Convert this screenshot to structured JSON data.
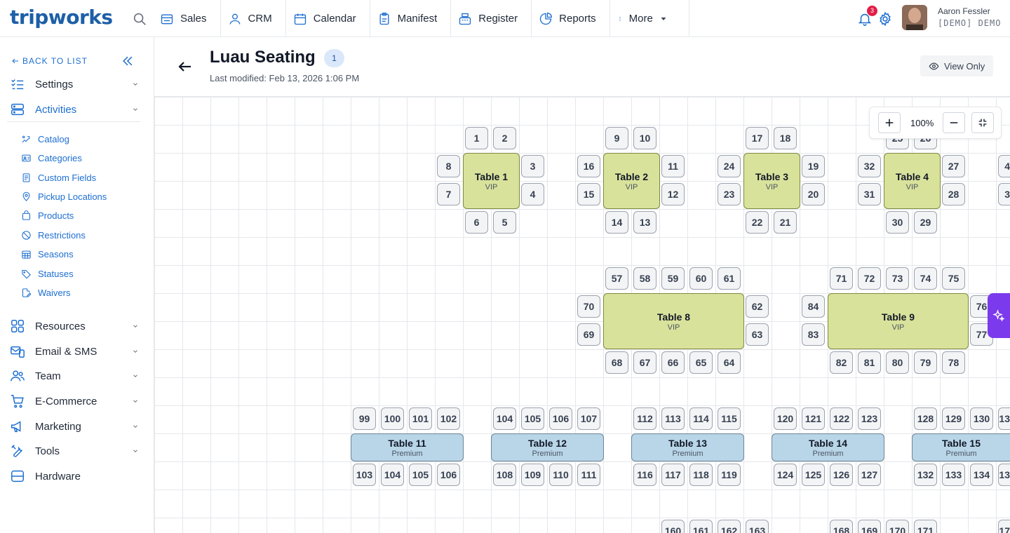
{
  "app": {
    "logo": "tripworks"
  },
  "nav": [
    {
      "key": "sales",
      "label": "Sales"
    },
    {
      "key": "crm",
      "label": "CRM"
    },
    {
      "key": "calendar",
      "label": "Calendar"
    },
    {
      "key": "manifest",
      "label": "Manifest"
    },
    {
      "key": "register",
      "label": "Register"
    },
    {
      "key": "reports",
      "label": "Reports"
    },
    {
      "key": "more",
      "label": "More"
    }
  ],
  "user": {
    "name": "Aaron Fessler",
    "org": "[DEMO] DEMO",
    "notifications": "3"
  },
  "sidebar": {
    "back_label": "BACK TO LIST",
    "sections": [
      {
        "label": "Settings",
        "icon": "settings-list-icon"
      },
      {
        "label": "Activities",
        "icon": "activities-stack-icon"
      },
      {
        "label": "Resources",
        "icon": "resources-grid-icon"
      },
      {
        "label": "Email & SMS",
        "icon": "email-sms-icon"
      },
      {
        "label": "Team",
        "icon": "team-icon"
      },
      {
        "label": "E-Commerce",
        "icon": "cart-icon"
      },
      {
        "label": "Marketing",
        "icon": "megaphone-icon"
      },
      {
        "label": "Tools",
        "icon": "tools-icon"
      },
      {
        "label": "Hardware",
        "icon": "hardware-icon"
      }
    ],
    "sub_items": [
      {
        "label": "Catalog",
        "icon": "catalog-icon"
      },
      {
        "label": "Categories",
        "icon": "categories-icon"
      },
      {
        "label": "Custom Fields",
        "icon": "custom-fields-icon"
      },
      {
        "label": "Pickup Locations",
        "icon": "pin-icon"
      },
      {
        "label": "Products",
        "icon": "bag-icon"
      },
      {
        "label": "Restrictions",
        "icon": "ban-icon"
      },
      {
        "label": "Seasons",
        "icon": "calendar-grid-icon"
      },
      {
        "label": "Statuses",
        "icon": "tag-icon"
      },
      {
        "label": "Waivers",
        "icon": "waiver-icon"
      }
    ]
  },
  "header": {
    "title": "Luau Seating",
    "badge": "1",
    "modified": "Last modified: Feb 13, 2026 1:06 PM",
    "view_only": "View Only"
  },
  "zoom": {
    "level": "100%"
  },
  "tables": [
    {
      "name": "Table 1",
      "type": "VIP"
    },
    {
      "name": "Table 2",
      "type": "VIP"
    },
    {
      "name": "Table 3",
      "type": "VIP"
    },
    {
      "name": "Table 4",
      "type": "VIP"
    },
    {
      "name": "Table 8",
      "type": "VIP"
    },
    {
      "name": "Table 9",
      "type": "VIP"
    },
    {
      "name": "Table 11",
      "type": "Premium"
    },
    {
      "name": "Table 12",
      "type": "Premium"
    },
    {
      "name": "Table 13",
      "type": "Premium"
    },
    {
      "name": "Table 14",
      "type": "Premium"
    },
    {
      "name": "Table 15",
      "type": "Premium"
    }
  ],
  "seats": {
    "t1": [
      "1",
      "2",
      "8",
      "7",
      "3",
      "4",
      "6",
      "5"
    ],
    "t2": [
      "9",
      "10",
      "16",
      "15",
      "11",
      "12",
      "14",
      "13"
    ],
    "t3": [
      "17",
      "18",
      "24",
      "23",
      "19",
      "20",
      "22",
      "21"
    ],
    "t4": [
      "25",
      "26",
      "32",
      "31",
      "27",
      "28",
      "30",
      "29"
    ],
    "t4_right_edge": [
      "4",
      "3"
    ],
    "t8": [
      "57",
      "58",
      "59",
      "60",
      "61",
      "70",
      "69",
      "62",
      "63",
      "68",
      "67",
      "66",
      "65",
      "64"
    ],
    "t9": [
      "71",
      "72",
      "73",
      "74",
      "75",
      "84",
      "83",
      "76",
      "77",
      "82",
      "81",
      "80",
      "79",
      "78"
    ],
    "t11": [
      "99",
      "100",
      "101",
      "102",
      "103",
      "104",
      "105",
      "106"
    ],
    "t12": [
      "104",
      "105",
      "106",
      "107",
      "108",
      "109",
      "110",
      "111"
    ],
    "t13": [
      "112",
      "113",
      "114",
      "115",
      "116",
      "117",
      "118",
      "119"
    ],
    "t14": [
      "120",
      "121",
      "122",
      "123",
      "124",
      "125",
      "126",
      "127"
    ],
    "t15": [
      "128",
      "129",
      "130",
      "13",
      "132",
      "133",
      "134",
      "13"
    ],
    "bottom": [
      "160",
      "161",
      "162",
      "163",
      "168",
      "169",
      "170",
      "171",
      "17"
    ]
  }
}
